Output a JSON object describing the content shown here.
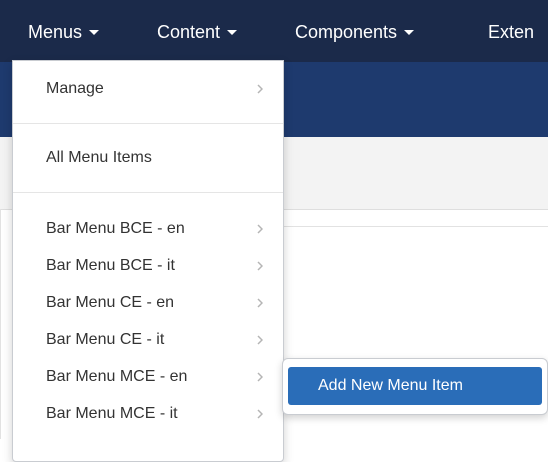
{
  "topnav": {
    "items": [
      {
        "label": "Menus",
        "active": true
      },
      {
        "label": "Content"
      },
      {
        "label": "Components"
      },
      {
        "label": "Exten"
      }
    ]
  },
  "menus_dropdown": {
    "manage": "Manage",
    "all_items": "All Menu Items",
    "menus": [
      "Bar Menu BCE - en",
      "Bar Menu BCE - it",
      "Bar Menu CE - en",
      "Bar Menu CE - it",
      "Bar Menu MCE - en",
      "Bar Menu MCE - it"
    ]
  },
  "submenu": {
    "add_new": "Add New Menu Item"
  },
  "colors": {
    "topbar": "#1b2a4a",
    "subheader": "#1e3a6e",
    "accent": "#2a6db8"
  }
}
